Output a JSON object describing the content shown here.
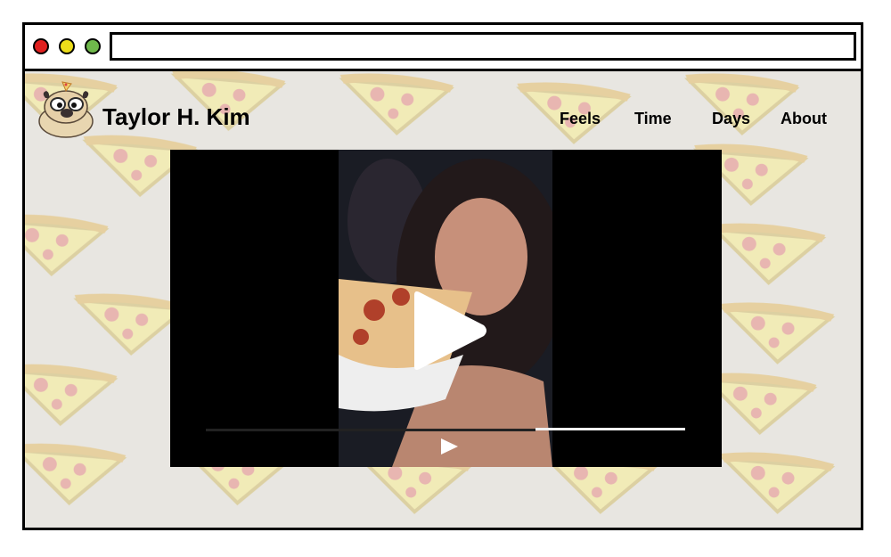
{
  "browser": {
    "address_value": "",
    "controls": [
      "close",
      "minimize",
      "zoom"
    ],
    "colors": {
      "close": "#e0201f",
      "minimize": "#ecdd1a",
      "zoom": "#6fb84b"
    }
  },
  "site": {
    "title": "Taylor H. Kim",
    "logo_icon": "pug-with-pizza-icon"
  },
  "nav": {
    "items": [
      {
        "label": "Feels"
      },
      {
        "label": "Time"
      },
      {
        "label": "Days"
      },
      {
        "label": "About"
      }
    ]
  },
  "video": {
    "progress": 0.69,
    "play_icon": "play-icon"
  },
  "background": {
    "pattern": "pizza-slice-pattern",
    "color": "#e8e6e1",
    "accent": "#f3e9a6"
  }
}
